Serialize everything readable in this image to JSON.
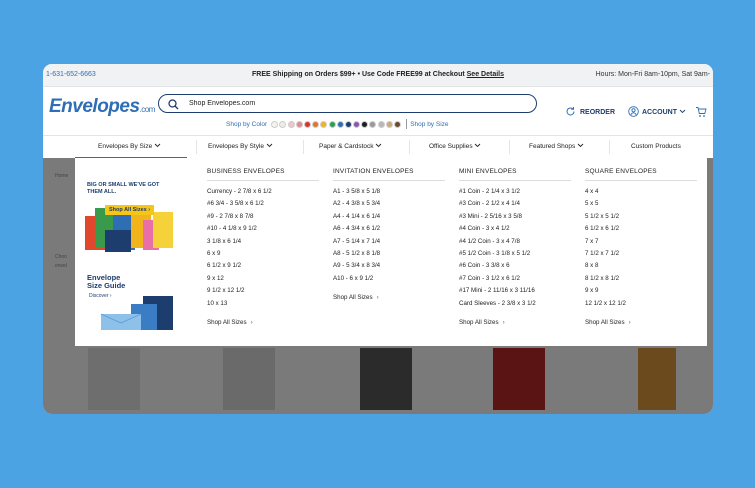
{
  "topbar": {
    "phone": "1-631-652-6663",
    "promo_text": "FREE Shipping on Orders $99+ • Use Code FREE99 at Checkout",
    "promo_link": "See Details",
    "hours": "Hours: Mon-Fri 8am-10pm, Sat 9am-"
  },
  "header": {
    "logo": "Envelopes",
    "logo_suffix": ".com",
    "search_placeholder": "Shop Envelopes.com",
    "shop_by_color": "Shop by Color",
    "shop_by_size": "Shop by Size",
    "reorder": "REORDER",
    "account": "ACCOUNT",
    "colors": [
      "#f3f3f3",
      "#f0ece4",
      "#f2c4c8",
      "#e48a8e",
      "#d9342b",
      "#e8722b",
      "#f2b41d",
      "#2e9e4e",
      "#2f6eb5",
      "#1d3d6e",
      "#8a55b8",
      "#1f1f1f",
      "#999999",
      "#b8b8b8",
      "#caa97a",
      "#6b4a2e"
    ],
    "brand_color": "#2f6eb5"
  },
  "nav": {
    "items": [
      "Envelopes By Size",
      "Envelopes By Style",
      "Paper & Cardstock",
      "Office Supplies",
      "Featured Shops",
      "Custom Products"
    ]
  },
  "page": {
    "crumb": "Home",
    "text1": "Choo",
    "text2": "envel"
  },
  "mega": {
    "promo1_text": "BIG OR SMALL WE'VE GOT THEM ALL.",
    "promo1_button": "Shop All Sizes",
    "promo2_line1": "Envelope",
    "promo2_line2": "Size Guide",
    "promo2_cta": "Discover",
    "columns": [
      {
        "heading": "BUSINESS ENVELOPES",
        "items": [
          "Currency - 2 7/8 x 6 1/2",
          "#6 3/4 - 3 5/8 x 6 1/2",
          "#9 - 2 7/8 x 8 7/8",
          "#10 - 4 1/8 x 9 1/2",
          "3 1/8 x 6 1/4",
          "6 x 9",
          "6 1/2 x 9 1/2",
          "9 x 12",
          "9 1/2 x 12 1/2",
          "10 x 13"
        ],
        "shop_all": "Shop All Sizes"
      },
      {
        "heading": "INVITATION ENVELOPES",
        "items": [
          "A1 - 3 5/8 x 5 1/8",
          "A2 - 4 3/8 x 5 3/4",
          "A4 - 4 1/4 x 6 1/4",
          "A6 - 4 3/4 x 6 1/2",
          "A7 - 5 1/4 x 7 1/4",
          "A8 - 5 1/2 x 8 1/8",
          "A9 - 5 3/4 x 8 3/4",
          "A10 - 6 x 9 1/2"
        ],
        "shop_all": "Shop All Sizes"
      },
      {
        "heading": "MINI ENVELOPES",
        "items": [
          "#1 Coin - 2 1/4 x 3 1/2",
          "#3 Coin - 2 1/2 x 4 1/4",
          "#3 Mini - 2 5/16 x 3 5/8",
          "#4 Coin - 3 x 4 1/2",
          "#4 1/2 Coin - 3 x 4 7/8",
          "#5 1/2 Coin - 3 1/8 x 5 1/2",
          "#6 Coin - 3 3/8 x 6",
          "#7 Coin - 3 1/2 x 6 1/2",
          "#17 Mini - 2 11/16 x 3 11/16",
          "Card Sleeves - 2 3/8 x 3 1/2"
        ],
        "shop_all": "Shop All Sizes"
      },
      {
        "heading": "SQUARE ENVELOPES",
        "items": [
          "4 x 4",
          "5 x 5",
          "5 1/2 x 5 1/2",
          "6 1/2 x 6 1/2",
          "7 x 7",
          "7 1/2 x 7 1/2",
          "8 x 8",
          "8 1/2 x 8 1/2",
          "9 x 9",
          "12 1/2 x 12 1/2"
        ],
        "shop_all": "Shop All Sizes"
      }
    ]
  }
}
